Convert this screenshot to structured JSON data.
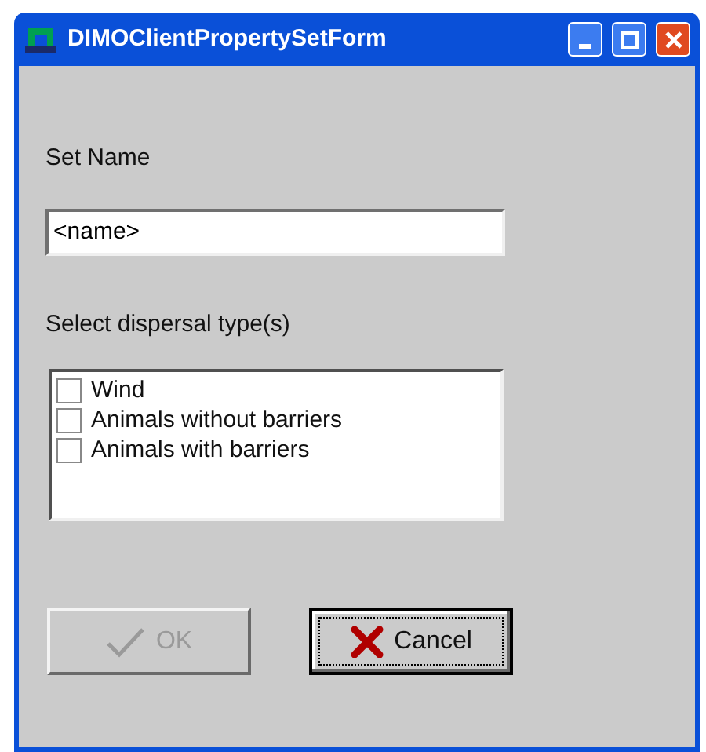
{
  "window": {
    "title": "DIMOClientPropertySetForm"
  },
  "set_name": {
    "label": "Set Name",
    "value": "<name>"
  },
  "dispersal": {
    "label": "Select dispersal type(s)",
    "options": [
      {
        "label": "Wind",
        "checked": false
      },
      {
        "label": "Animals without barriers",
        "checked": false
      },
      {
        "label": "Animals with barriers",
        "checked": false
      }
    ]
  },
  "buttons": [
    {
      "kind": "ok",
      "label": "OK",
      "disabled": true,
      "focused": false
    },
    {
      "kind": "cancel",
      "label": "Cancel",
      "disabled": false,
      "focused": true
    }
  ]
}
